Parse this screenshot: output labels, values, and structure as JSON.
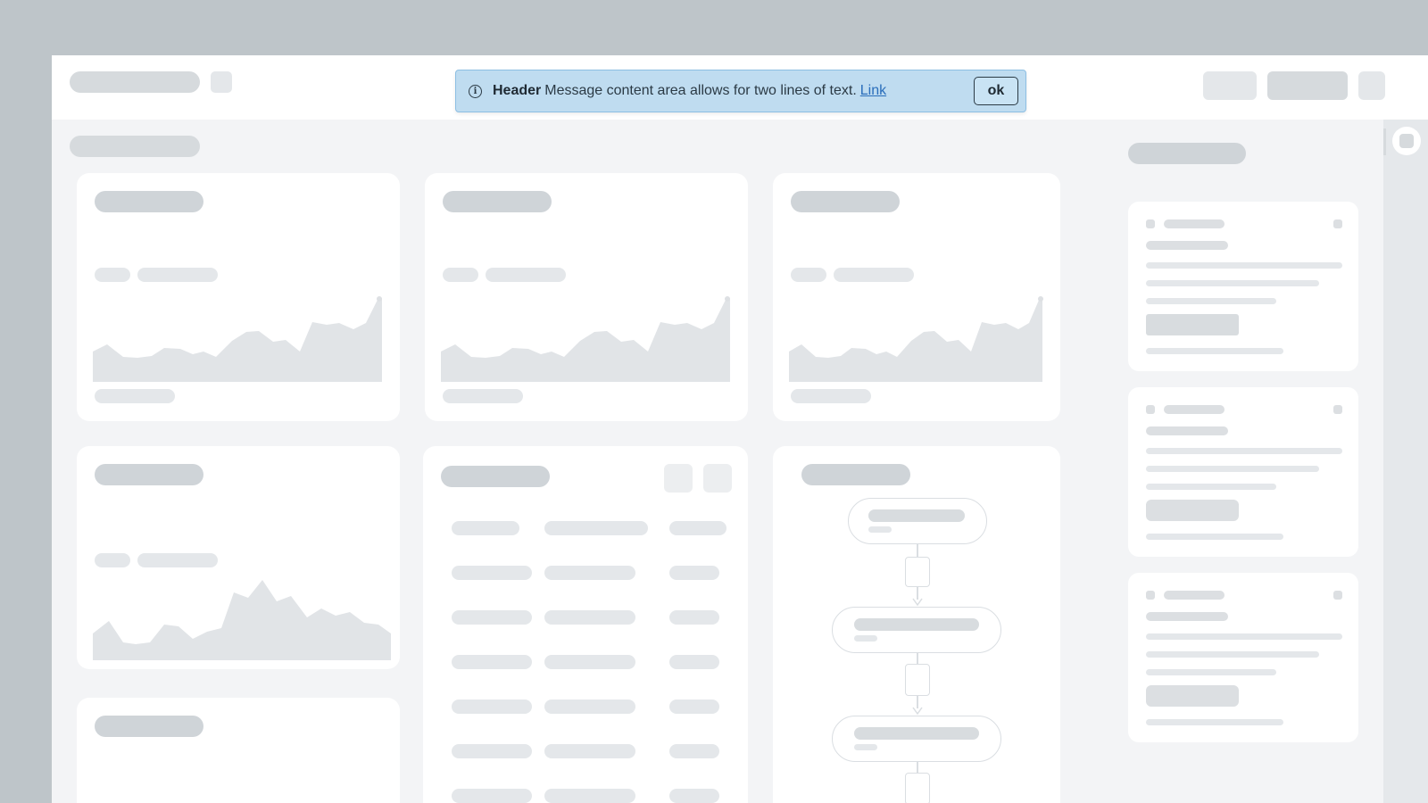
{
  "notification": {
    "icon": "info-icon",
    "header": "Header",
    "message": "Message content area allows for two lines of text.",
    "link_label": "Link",
    "ok_label": "ok",
    "background_color": "#bfdcf0",
    "link_color": "#2a6ebb"
  },
  "colors": {
    "page_background": "#bec5c9",
    "window_background": "#f3f4f6",
    "card_background": "#ffffff",
    "skeleton": "#d6dadd",
    "chart_fill": "#e1e4e7"
  }
}
